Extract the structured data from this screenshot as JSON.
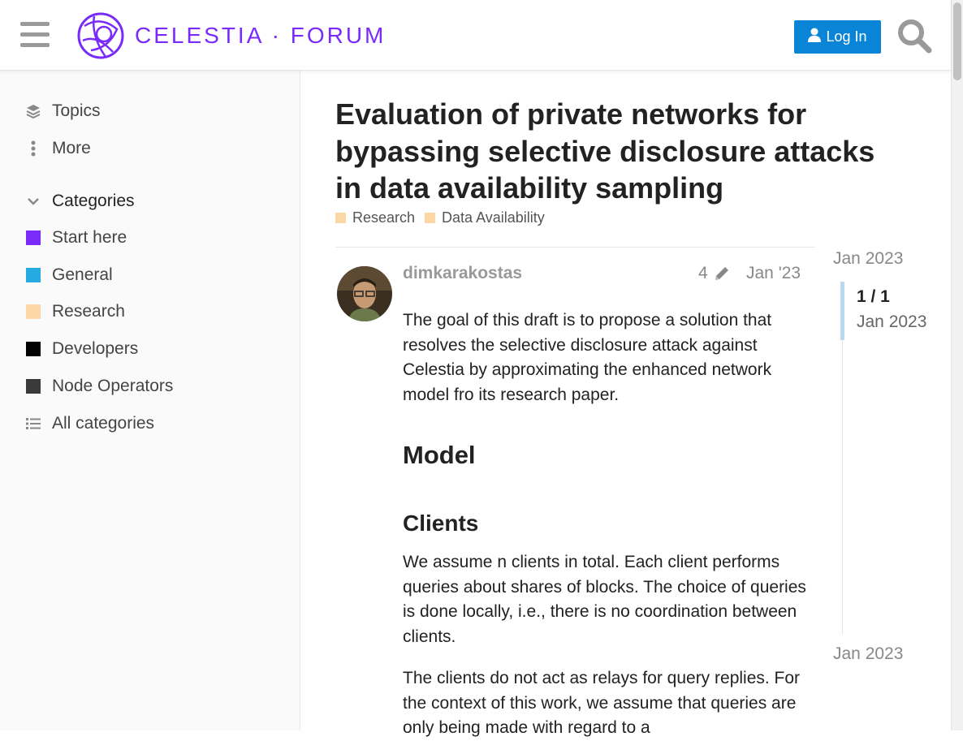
{
  "header": {
    "logo_text": "CELESTIA · FORUM",
    "brand_color": "#7b2bf9",
    "login_label": "Log In",
    "login_color": "#0a84d6",
    "icons": [
      "hamburger-icon",
      "celestia-logo-icon",
      "user-icon",
      "search-icon"
    ]
  },
  "sidebar": {
    "topics_label": "Topics",
    "more_label": "More",
    "categories_label": "Categories",
    "categories": [
      {
        "label": "Start here",
        "color": "#7b2bf9"
      },
      {
        "label": "General",
        "color": "#25aae1"
      },
      {
        "label": "Research",
        "color": "#fcd8a6"
      },
      {
        "label": "Developers",
        "color": "#000000"
      },
      {
        "label": "Node Operators",
        "color": "#3a3a3a"
      }
    ],
    "all_categories_label": "All categories"
  },
  "topic": {
    "title": "Evaluation of private networks for bypassing selective disclosure attacks in data availability sampling",
    "tags": [
      {
        "label": "Research",
        "color": "#fcd8a6"
      },
      {
        "label": "Data Availability",
        "color": "#fcd8a6"
      }
    ]
  },
  "post": {
    "username": "dimkarakostas",
    "edit_count": "4",
    "date": "Jan '23",
    "paragraph1": "The goal of this draft is to propose a solution that resolves the selective disclosure attack against Celestia by approximating the enhanced network model fro its research paper.",
    "heading_model": "Model",
    "heading_clients": "Clients",
    "paragraph2": "We assume n clients in total. Each client performs queries about shares of blocks. The choice of queries is done locally, i.e., there is no coordination between clients.",
    "paragraph3": "The clients do not act as relays for query replies. For the context of this work, we assume that queries are only being made with regard to a"
  },
  "timeline": {
    "start_date": "Jan 2023",
    "count": "1 / 1",
    "count_date": "Jan 2023",
    "end_date": "Jan 2023"
  }
}
